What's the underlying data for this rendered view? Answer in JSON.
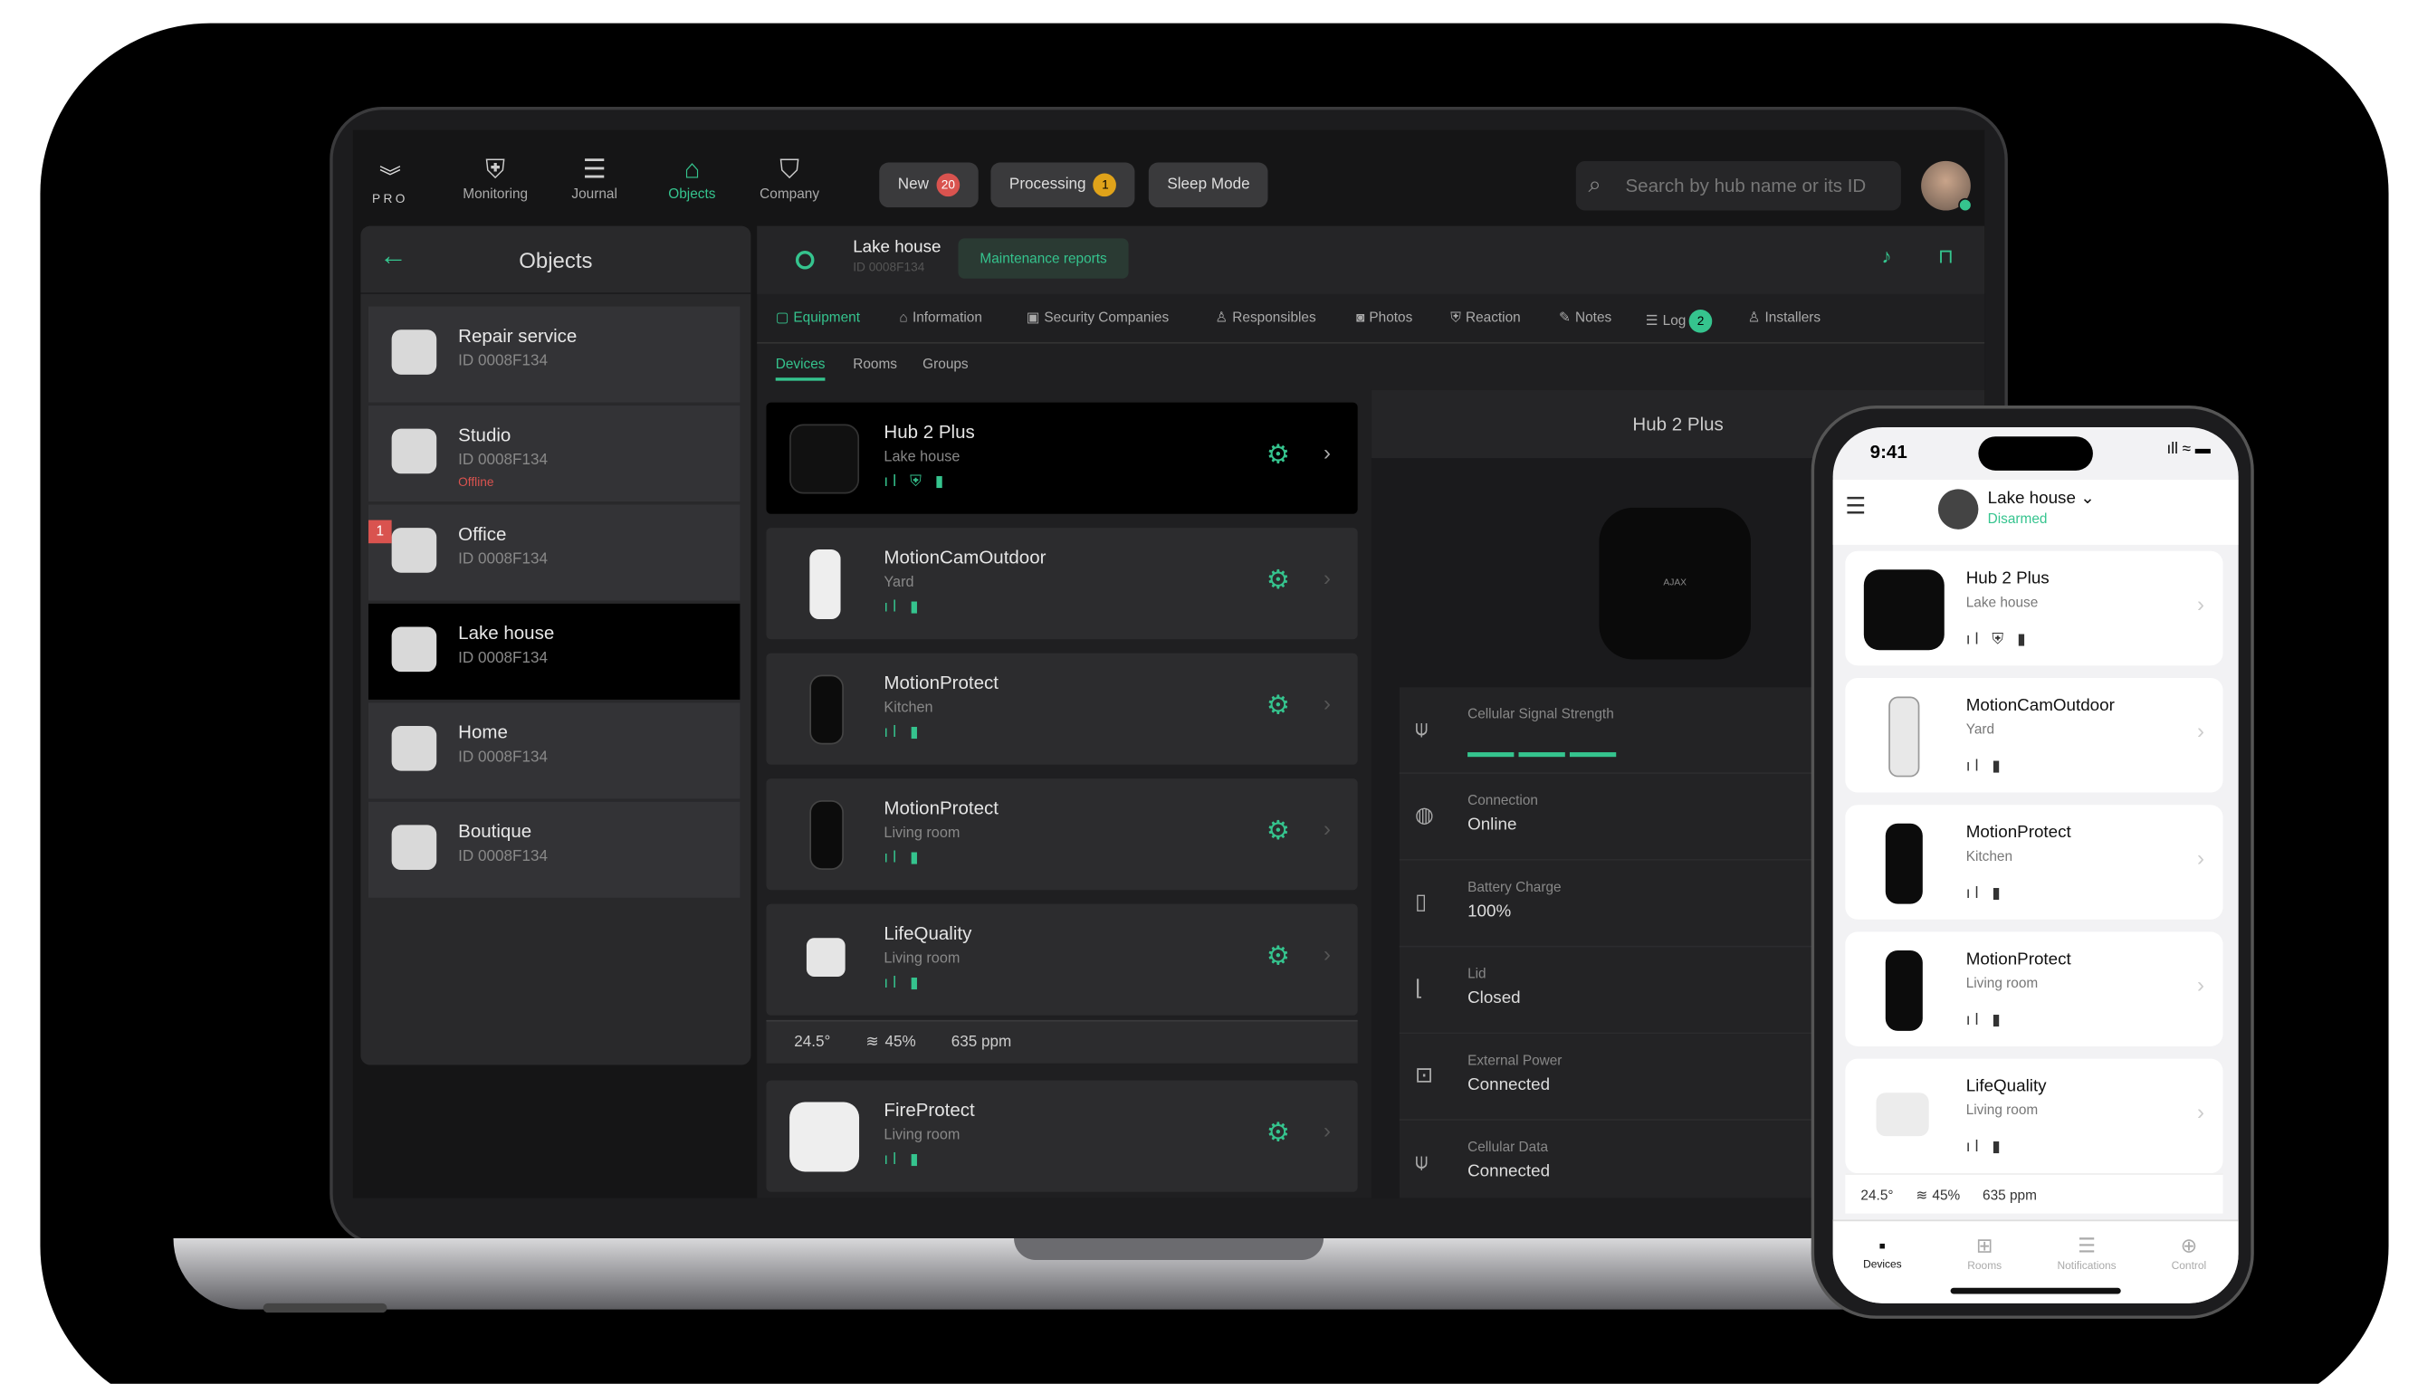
{
  "topbar": {
    "logo_text": "PRO",
    "nav": [
      {
        "label": "Monitoring",
        "icon": "siren-icon"
      },
      {
        "label": "Journal",
        "icon": "journal-icon"
      },
      {
        "label": "Objects",
        "icon": "house-icon"
      },
      {
        "label": "Company",
        "icon": "shield-icon"
      }
    ],
    "pills": [
      {
        "label": "New",
        "count": "20"
      },
      {
        "label": "Processing",
        "count": "1"
      },
      {
        "label": "Sleep Mode"
      }
    ],
    "search_placeholder": "Search by hub name or its ID"
  },
  "objects": {
    "title": "Objects",
    "items": [
      {
        "name": "Repair service",
        "id": "ID 0008F134"
      },
      {
        "name": "Studio",
        "id": "ID 0008F134",
        "status": "Offline"
      },
      {
        "name": "Office",
        "id": "ID 0008F134",
        "alert_count": "1"
      },
      {
        "name": "Lake house",
        "id": "ID 0008F134"
      },
      {
        "name": "Home",
        "id": "ID 0008F134"
      },
      {
        "name": "Boutique",
        "id": "ID 0008F134"
      }
    ]
  },
  "hub": {
    "name": "Lake house",
    "id": "ID 0008F134",
    "maintenance_label": "Maintenance reports",
    "tabs": [
      {
        "label": "Equipment"
      },
      {
        "label": "Information"
      },
      {
        "label": "Security Companies"
      },
      {
        "label": "Responsibles"
      },
      {
        "label": "Photos"
      },
      {
        "label": "Reaction"
      },
      {
        "label": "Notes"
      },
      {
        "label": "Log",
        "badge": "2"
      },
      {
        "label": "Installers"
      }
    ],
    "subtabs": [
      "Devices",
      "Rooms",
      "Groups"
    ]
  },
  "devices": [
    {
      "name": "Hub 2 Plus",
      "room": "Lake house",
      "status": "📶 ⚠ 🔋"
    },
    {
      "name": "MotionCamOutdoor",
      "room": "Yard",
      "status": "📶 🔋"
    },
    {
      "name": "MotionProtect",
      "room": "Kitchen",
      "status": "📶 🔋"
    },
    {
      "name": "MotionProtect",
      "room": "Living room",
      "status": "📶 🔋"
    },
    {
      "name": "LifeQuality",
      "room": "Living room",
      "status": "📶 🔋"
    },
    {
      "name": "FireProtect",
      "room": "Living room",
      "status": "📶 🔋"
    }
  ],
  "sensors": {
    "temp": "24.5°",
    "humidity": "45%",
    "co2": "635 ppm"
  },
  "detail": {
    "title": "Hub 2 Plus",
    "logo": "AJAX",
    "props": [
      {
        "label": "Cellular Signal Strength",
        "value": ""
      },
      {
        "label": "Connection",
        "value": "Online"
      },
      {
        "label": "Battery Charge",
        "value": "100%"
      },
      {
        "label": "Lid",
        "value": "Closed"
      },
      {
        "label": "External Power",
        "value": "Connected"
      },
      {
        "label": "Cellular Data",
        "value": "Connected"
      }
    ]
  },
  "phone": {
    "time": "9:41",
    "hub_name": "Lake house",
    "hub_status": "Disarmed",
    "devices": [
      {
        "name": "Hub 2 Plus",
        "room": "Lake house"
      },
      {
        "name": "MotionCamOutdoor",
        "room": "Yard"
      },
      {
        "name": "MotionProtect",
        "room": "Kitchen"
      },
      {
        "name": "MotionProtect",
        "room": "Living room"
      },
      {
        "name": "LifeQuality",
        "room": "Living room"
      }
    ],
    "tabs": [
      "Devices",
      "Rooms",
      "Notifications",
      "Control"
    ]
  },
  "colors": {
    "accent": "#35c48e",
    "alert": "#d9534f",
    "count_badge": "#e0a31a"
  }
}
